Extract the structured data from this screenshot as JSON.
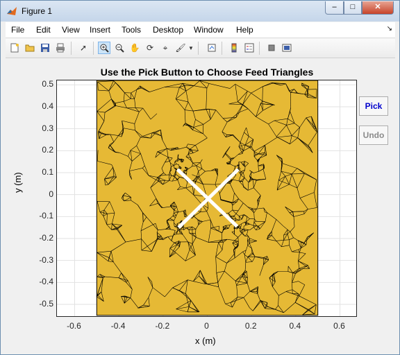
{
  "window": {
    "title": "Figure 1"
  },
  "menu": {
    "items": [
      "File",
      "Edit",
      "View",
      "Insert",
      "Tools",
      "Desktop",
      "Window",
      "Help"
    ]
  },
  "toolbar": {
    "icons": [
      "new-figure-icon",
      "open-file-icon",
      "save-icon",
      "print-icon",
      "pointer-icon",
      "zoom-in-icon",
      "zoom-out-icon",
      "pan-icon",
      "rotate-3d-icon",
      "data-cursor-icon",
      "brush-icon",
      "link-plot-icon",
      "colorbar-icon",
      "legend-icon",
      "hide-plot-tools-icon",
      "show-plot-tools-icon"
    ]
  },
  "plot": {
    "title": "Use the Pick Button to Choose Feed Triangles",
    "xlabel": "x (m)",
    "ylabel": "y (m)",
    "yticks": [
      "0.5",
      "0.4",
      "0.3",
      "0.2",
      "0.1",
      "0",
      "-0.1",
      "-0.2",
      "-0.3",
      "-0.4",
      "-0.5"
    ],
    "xticks": [
      "-0.6",
      "-0.4",
      "-0.2",
      "0",
      "0.2",
      "0.4",
      "0.6"
    ],
    "mesh_color": "#E6B935"
  },
  "buttons": {
    "pick": "Pick",
    "undo": "Undo"
  },
  "chart_data": {
    "type": "scatter",
    "title": "Use the Pick Button to Choose Feed Triangles",
    "xlabel": "x (m)",
    "ylabel": "y (m)",
    "xlim": [
      -0.68,
      0.68
    ],
    "ylim": [
      -0.56,
      0.52
    ],
    "xticks": [
      -0.6,
      -0.4,
      -0.2,
      0,
      0.2,
      0.4,
      0.6
    ],
    "yticks": [
      -0.5,
      -0.4,
      -0.3,
      -0.2,
      -0.1,
      0,
      0.1,
      0.2,
      0.3,
      0.4,
      0.5
    ],
    "ground_plane": {
      "x": [
        -0.5,
        0.5
      ],
      "y": [
        -0.55,
        0.52
      ]
    },
    "dipole_arms": [
      {
        "x1": -0.135,
        "y1": 0.115,
        "x2": 0.135,
        "y2": -0.145
      },
      {
        "x1": 0.14,
        "y1": 0.115,
        "x2": -0.13,
        "y2": -0.15
      }
    ],
    "grid": true
  }
}
